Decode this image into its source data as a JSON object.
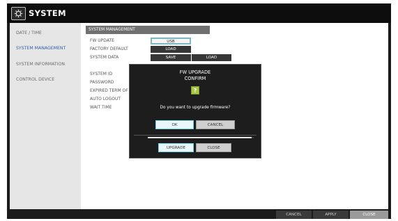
{
  "window": {
    "title": "SYSTEM",
    "icon": "system-settings-icon"
  },
  "sidebar": {
    "items": [
      {
        "label": "DATE / TIME",
        "active": false
      },
      {
        "label": "SYSTEM MANAGEMENT",
        "active": true
      },
      {
        "label": "SYSTEM INFORMATION",
        "active": false
      },
      {
        "label": "CONTROL DEVICE",
        "active": false
      }
    ]
  },
  "main": {
    "section_title": "SYSTEM MANAGEMENT",
    "rows": {
      "fw_update": {
        "label": "FW UPDATE",
        "button": "USB"
      },
      "factory_default": {
        "label": "FACTORY DEFAULT",
        "button": "LOAD"
      },
      "system_data": {
        "label": "SYSTEM DATA",
        "save": "SAVE",
        "load": "LOAD"
      }
    },
    "settings_labels": [
      "SYSTEM ID",
      "PASSWORD",
      "EXPIRED TERM OF PASS",
      "AUTO LOGOUT",
      "WAIT TIME"
    ]
  },
  "dialog": {
    "title_line1": "FW UPGRADE",
    "title_line2": "CONFIRM",
    "icon": "question-icon",
    "icon_glyph": "?",
    "message": "Do you want to upgrade firmware?",
    "ok": "OK",
    "cancel": "CANCEL",
    "progress": 0.98,
    "upgrade": "UPGRADE",
    "close": "CLOSE"
  },
  "bottombar": {
    "cancel": "CANCEL",
    "apply": "APPLY",
    "close": "CLOSE"
  },
  "colors": {
    "titlebar": "#0d0d0d",
    "active_nav": "#2d5fa8",
    "accent": "#5fc4da",
    "dialog_bg": "#1d1d1d",
    "section_header": "#707070",
    "question_icon": "#a9c84a"
  }
}
